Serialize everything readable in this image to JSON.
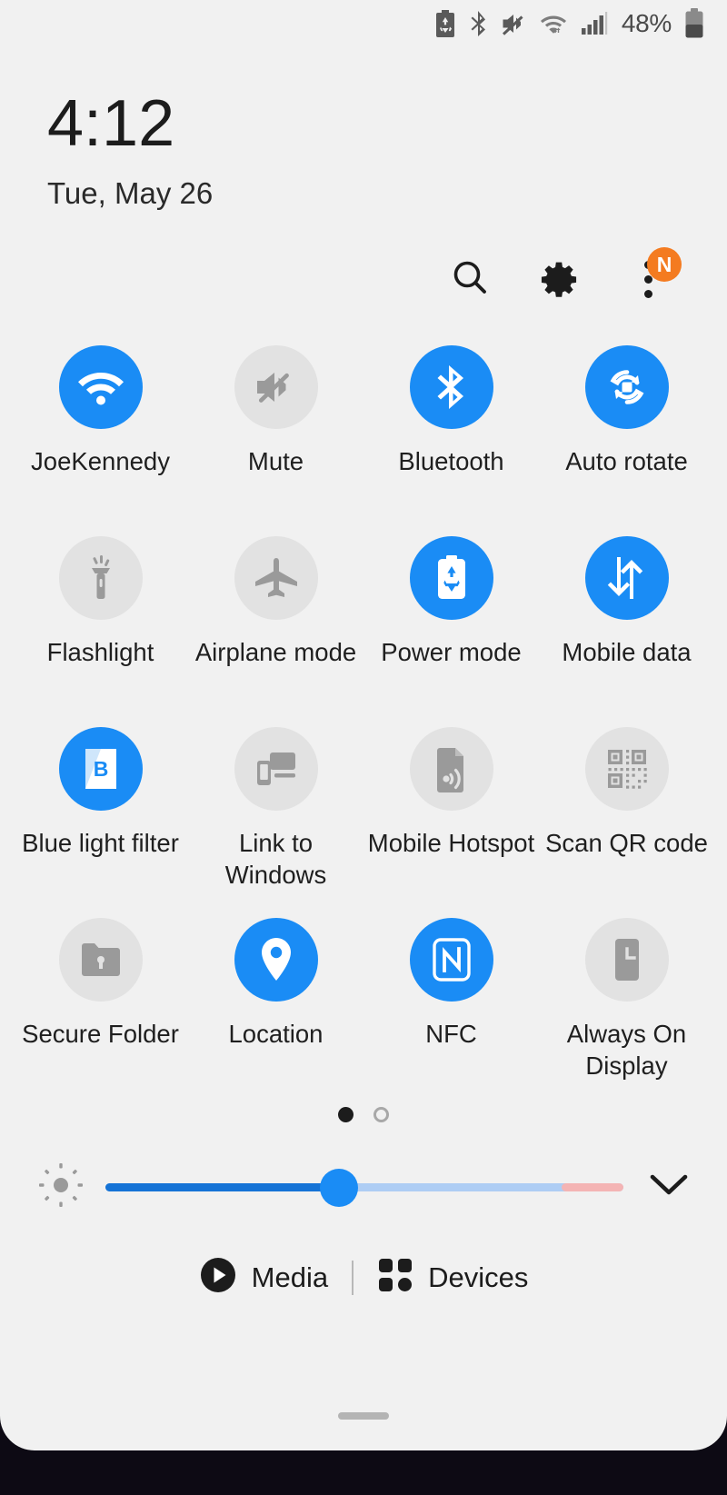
{
  "statusbar": {
    "icons": [
      "power-saving-battery-icon",
      "bluetooth-icon",
      "mute-icon",
      "wifi-transfer-icon",
      "signal-bars-icon"
    ],
    "battery_percent": "48%"
  },
  "clock": {
    "time": "4:12",
    "date": "Tue, May 26"
  },
  "header": {
    "search_label": "search-icon",
    "settings_label": "gear-icon",
    "menu_label": "more-options-icon",
    "badge_text": "N",
    "badge_color": "#f47b20"
  },
  "tiles": [
    {
      "label": "JoeKennedy",
      "icon": "wifi-icon",
      "state": "on"
    },
    {
      "label": "Mute",
      "icon": "mute-icon",
      "state": "off"
    },
    {
      "label": "Bluetooth",
      "icon": "bluetooth-icon",
      "state": "on"
    },
    {
      "label": "Auto rotate",
      "icon": "auto-rotate-icon",
      "state": "on"
    },
    {
      "label": "Flashlight",
      "icon": "flashlight-icon",
      "state": "off"
    },
    {
      "label": "Airplane mode",
      "icon": "airplane-icon",
      "state": "off"
    },
    {
      "label": "Power mode",
      "icon": "power-mode-icon",
      "state": "on"
    },
    {
      "label": "Mobile data",
      "icon": "mobile-data-icon",
      "state": "on"
    },
    {
      "label": "Blue light filter",
      "icon": "blue-light-icon",
      "state": "on"
    },
    {
      "label": "Link to Windows",
      "icon": "link-windows-icon",
      "state": "off"
    },
    {
      "label": "Mobile Hotspot",
      "icon": "hotspot-icon",
      "state": "off"
    },
    {
      "label": "Scan QR code",
      "icon": "qr-code-icon",
      "state": "off"
    },
    {
      "label": "Secure Folder",
      "icon": "secure-folder-icon",
      "state": "off"
    },
    {
      "label": "Location",
      "icon": "location-pin-icon",
      "state": "on"
    },
    {
      "label": "NFC",
      "icon": "nfc-icon",
      "state": "on"
    },
    {
      "label": "Always On Display",
      "icon": "always-on-icon",
      "state": "off"
    }
  ],
  "pager": {
    "pages": 2,
    "active_page": 1
  },
  "brightness": {
    "icon": "brightness-sun-icon",
    "value_percent": 45,
    "warn_start_percent": 88,
    "expand_icon": "chevron-down-icon",
    "accent": "#1a8cf5"
  },
  "footer": {
    "media_label": "Media",
    "media_icon": "play-circle-icon",
    "devices_label": "Devices",
    "devices_icon": "grid-squares-icon"
  },
  "colors": {
    "panel_bg": "#f1f1f1",
    "tile_on": "#1a8cf5",
    "tile_off": "#e2e2e2",
    "text": "#1c1c1c"
  }
}
